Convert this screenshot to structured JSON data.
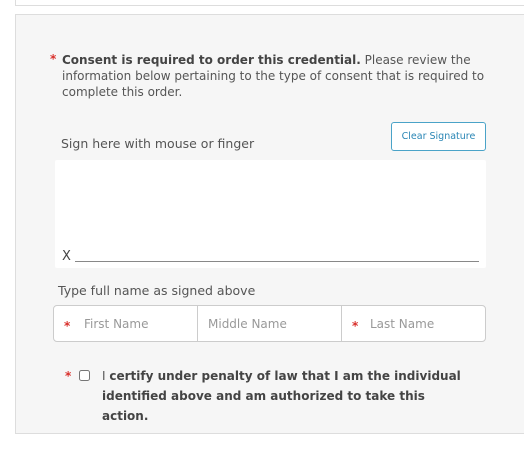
{
  "consent": {
    "required_mark": "*",
    "bold_text": "Consent is required to order this credential.",
    "text": " Please review the information below pertaining to the type of consent that is required to complete this order."
  },
  "signature": {
    "label": "Sign here with mouse or finger",
    "clear_button_label": "Clear Signature",
    "x_mark": "X"
  },
  "name": {
    "label": "Type full name as signed above",
    "first": {
      "placeholder": "First Name",
      "required_mark": "*"
    },
    "middle": {
      "placeholder": "Middle Name"
    },
    "last": {
      "placeholder": "Last Name",
      "required_mark": "*"
    }
  },
  "certify": {
    "required_mark": "*",
    "prefix": "I ",
    "bold_text": "certify under penalty of law that I am the individual identified above and am authorized to take this action."
  },
  "colors": {
    "required": "#d9302c",
    "accent": "#2a86b5",
    "panel_background": "#f6f6f6"
  }
}
